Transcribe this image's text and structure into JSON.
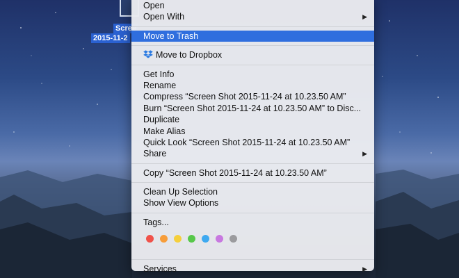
{
  "desktop": {
    "file_label_line1": "Scree",
    "file_label_line2": "2015-11-2"
  },
  "menu": {
    "open": "Open",
    "open_with": "Open With",
    "move_to_trash": "Move to Trash",
    "move_to_dropbox": "Move to Dropbox",
    "get_info": "Get Info",
    "rename": "Rename",
    "compress": "Compress “Screen Shot 2015-11-24 at 10.23.50 AM”",
    "burn": "Burn “Screen Shot 2015-11-24 at 10.23.50 AM” to Disc...",
    "duplicate": "Duplicate",
    "make_alias": "Make Alias",
    "quick_look": "Quick Look “Screen Shot 2015-11-24 at 10.23.50 AM”",
    "share": "Share",
    "copy": "Copy “Screen Shot 2015-11-24 at 10.23.50 AM”",
    "clean_up": "Clean Up Selection",
    "view_options": "Show View Options",
    "tags": "Tags...",
    "services": "Services",
    "submenu_arrow": "▶",
    "tag_colors": [
      "#f0524a",
      "#f79d3a",
      "#f5cf3c",
      "#57c84a",
      "#3ea9f0",
      "#c879e0",
      "#9b9b9e"
    ]
  }
}
